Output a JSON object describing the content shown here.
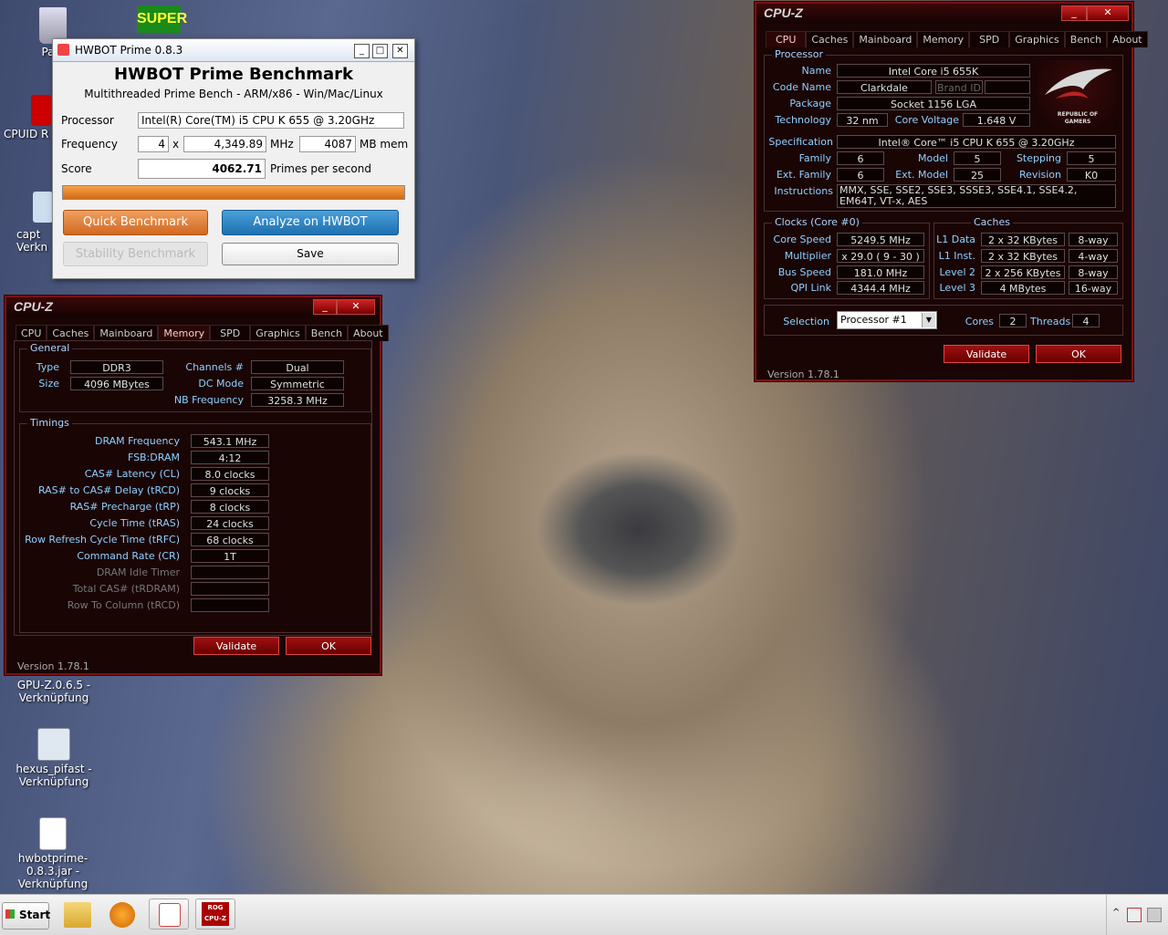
{
  "desktop": {
    "icons": [
      {
        "label": "Papi"
      },
      {
        "label": "CPUID R"
      },
      {
        "label": "capt Verkn"
      },
      {
        "label": "GPU-Z.0.6.5 - Verknüpfung"
      },
      {
        "label": "hexus_pifast - Verknüpfung"
      },
      {
        "label": "hwbotprime-0.8.3.jar - Verknüpfung"
      }
    ],
    "super_label": "SUPER"
  },
  "hwbot": {
    "window_title": "HWBOT Prime 0.8.3",
    "heading": "HWBOT Prime Benchmark",
    "subheading": "Multithreaded Prime Bench - ARM/x86 - Win/Mac/Linux",
    "processor_label": "Processor",
    "processor_value": "Intel(R) Core(TM) i5 CPU      K 655  @ 3.20GHz",
    "frequency_label": "Frequency",
    "cores": "4",
    "x": "x",
    "freq_value": "4,349.89",
    "mhz": "MHz",
    "mem_value": "4087",
    "mb_mem": "MB mem",
    "score_label": "Score",
    "score_value": "4062.71",
    "primes": "Primes per second",
    "progress": 1.0,
    "quick_btn": "Quick Benchmark",
    "analyze_btn": "Analyze on HWBOT",
    "stability_btn": "Stability Benchmark",
    "save_btn": "Save"
  },
  "cpuz_mem": {
    "title": "CPU-Z",
    "tabs": [
      "CPU",
      "Caches",
      "Mainboard",
      "Memory",
      "SPD",
      "Graphics",
      "Bench",
      "About"
    ],
    "active_tab": "Memory",
    "general_title": "General",
    "type_label": "Type",
    "type_value": "DDR3",
    "size_label": "Size",
    "size_value": "4096 MBytes",
    "channels_label": "Channels #",
    "channels_value": "Dual",
    "dcmode_label": "DC Mode",
    "dcmode_value": "Symmetric",
    "nbfreq_label": "NB Frequency",
    "nbfreq_value": "3258.3 MHz",
    "timings_title": "Timings",
    "timings": [
      {
        "label": "DRAM Frequency",
        "value": "543.1 MHz"
      },
      {
        "label": "FSB:DRAM",
        "value": "4:12"
      },
      {
        "label": "CAS# Latency (CL)",
        "value": "8.0 clocks"
      },
      {
        "label": "RAS# to CAS# Delay (tRCD)",
        "value": "9 clocks"
      },
      {
        "label": "RAS# Precharge (tRP)",
        "value": "8 clocks"
      },
      {
        "label": "Cycle Time (tRAS)",
        "value": "24 clocks"
      },
      {
        "label": "Row Refresh Cycle Time (tRFC)",
        "value": "68 clocks"
      },
      {
        "label": "Command Rate (CR)",
        "value": "1T"
      },
      {
        "label": "DRAM Idle Timer",
        "value": ""
      },
      {
        "label": "Total CAS# (tRDRAM)",
        "value": ""
      },
      {
        "label": "Row To Column (tRCD)",
        "value": ""
      }
    ],
    "validate_btn": "Validate",
    "ok_btn": "OK",
    "version": "Version 1.78.1"
  },
  "cpuz_cpu": {
    "title": "CPU-Z",
    "tabs": [
      "CPU",
      "Caches",
      "Mainboard",
      "Memory",
      "SPD",
      "Graphics",
      "Bench",
      "About"
    ],
    "active_tab": "CPU",
    "processor_title": "Processor",
    "name_label": "Name",
    "name_value": "Intel Core i5 655K",
    "codename_label": "Code Name",
    "codename_value": "Clarkdale",
    "brandid_label": "Brand ID",
    "package_label": "Package",
    "package_value": "Socket 1156 LGA",
    "technology_label": "Technology",
    "technology_value": "32 nm",
    "corevoltage_label": "Core Voltage",
    "corevoltage_value": "1.648 V",
    "rog_text": "REPUBLIC OF GAMERS",
    "spec_label": "Specification",
    "spec_value": "Intel® Core™ i5 CPU      K 655  @ 3.20GHz",
    "family_label": "Family",
    "family_value": "6",
    "model_label": "Model",
    "model_value": "5",
    "stepping_label": "Stepping",
    "stepping_value": "5",
    "extfamily_label": "Ext. Family",
    "extfamily_value": "6",
    "extmodel_label": "Ext. Model",
    "extmodel_value": "25",
    "revision_label": "Revision",
    "revision_value": "K0",
    "instructions_label": "Instructions",
    "instructions_value": "MMX, SSE, SSE2, SSE3, SSSE3, SSE4.1, SSE4.2, EM64T, VT-x, AES",
    "clocks_title": "Clocks (Core #0)",
    "corespeed_label": "Core Speed",
    "corespeed_value": "5249.5 MHz",
    "multiplier_label": "Multiplier",
    "multiplier_value": "x 29.0 ( 9 - 30 )",
    "busspeed_label": "Bus Speed",
    "busspeed_value": "181.0 MHz",
    "qpilink_label": "QPI Link",
    "qpilink_value": "4344.4 MHz",
    "caches_title": "Caches",
    "l1data_label": "L1 Data",
    "l1data_value": "2 x 32 KBytes",
    "l1data_way": "8-way",
    "l1inst_label": "L1 Inst.",
    "l1inst_value": "2 x 32 KBytes",
    "l1inst_way": "4-way",
    "l2_label": "Level 2",
    "l2_value": "2 x 256 KBytes",
    "l2_way": "8-way",
    "l3_label": "Level 3",
    "l3_value": "4 MBytes",
    "l3_way": "16-way",
    "selection_label": "Selection",
    "selection_value": "Processor #1",
    "cores_label": "Cores",
    "cores_value": "2",
    "threads_label": "Threads",
    "threads_value": "4",
    "validate_btn": "Validate",
    "ok_btn": "OK",
    "version": "Version 1.78.1"
  },
  "taskbar": {
    "start_label": "Start",
    "cpuz_icon_text": "ROG CPU-Z"
  }
}
